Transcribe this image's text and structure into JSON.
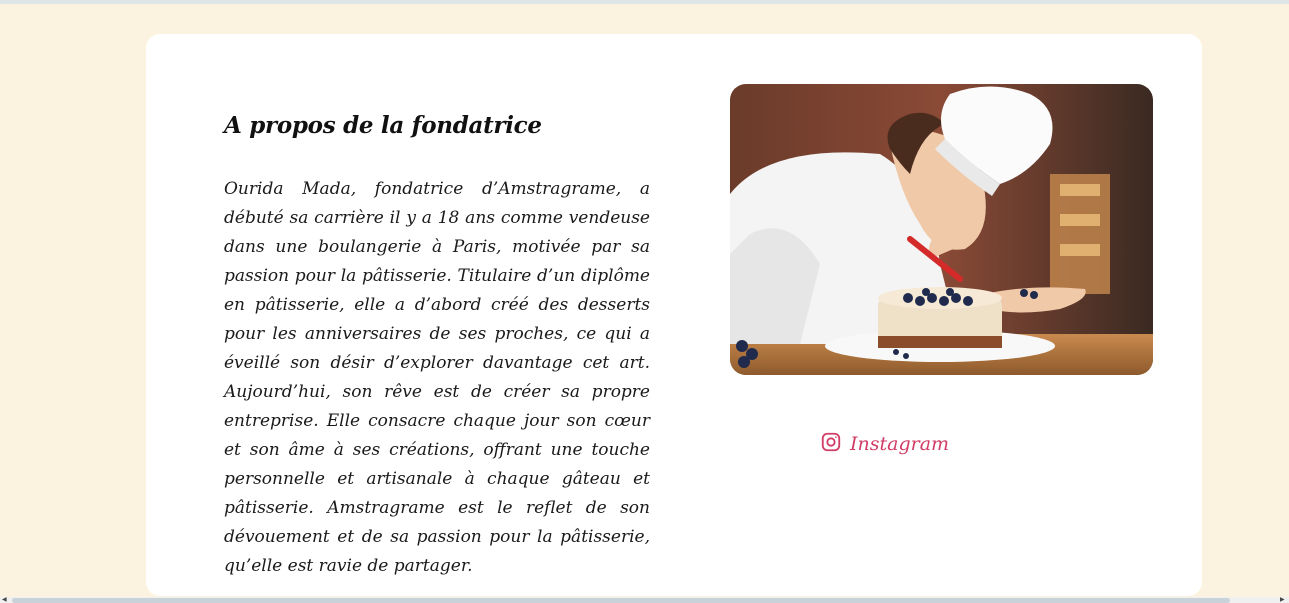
{
  "about": {
    "title": "A propos de la fondatrice",
    "bio": "Ourida Mada, fondatrice d’Amstragrame, a débuté sa carrière il y a 18 ans comme vendeuse dans une boulangerie à Paris, motivée par sa passion pour la pâtisserie. Titulaire d’un diplôme en pâtisserie, elle a d’abord créé des desserts pour les anniversaires de ses proches, ce qui a éveillé son désir d’explorer davantage cet art. Aujourd’hui, son rêve est de créer sa propre entreprise. Elle consacre chaque jour son cœur et son âme à ses créations, offrant une touche personnelle et artisanale à chaque gâteau et pâtisserie. Amstragrame est le reflet de son dévouement et de sa passion pour la pâtisserie, qu’elle est ravie de partager."
  },
  "photo": {
    "icon": "chef-photo"
  },
  "social": {
    "instagram_label": "Instagram",
    "icon": "instagram-icon",
    "color": "#d13d66"
  },
  "colors": {
    "page_background": "#fbf3df",
    "card_background": "#ffffff"
  }
}
